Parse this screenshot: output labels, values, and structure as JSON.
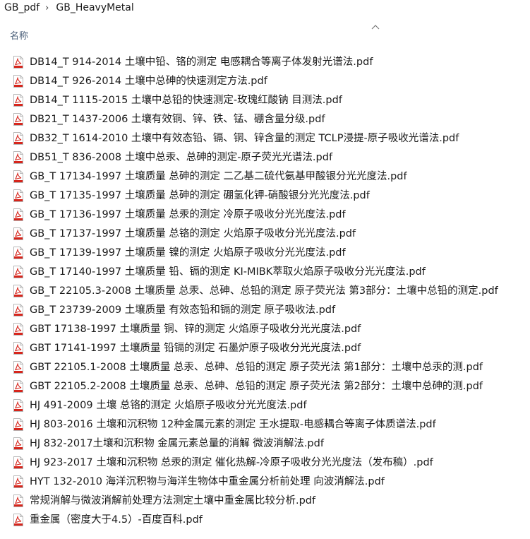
{
  "breadcrumb": {
    "items": [
      "GB_pdf",
      "GB_HeavyMetal"
    ],
    "separator": "›"
  },
  "column_header": {
    "name_label": "名称"
  },
  "files": [
    {
      "name": "DB14_T 914-2014 土壤中铅、铬的测定 电感耦合等离子体发射光谱法.pdf",
      "icon": "pdf-file-icon"
    },
    {
      "name": "DB14_T 926-2014 土壤中总砷的快速测定方法.pdf",
      "icon": "pdf-file-icon"
    },
    {
      "name": "DB14_T 1115-2015 土壤中总铅的快速测定-玫瑰红酸钠 目测法.pdf",
      "icon": "pdf-file-icon"
    },
    {
      "name": "DB21_T 1437-2006 土壤有效铜、锌、铁、锰、硼含量分级.pdf",
      "icon": "pdf-file-icon"
    },
    {
      "name": "DB32_T 1614-2010 土壤中有效态铅、镉、铜、锌含量的测定 TCLP浸提-原子吸收光谱法.pdf",
      "icon": "pdf-file-icon"
    },
    {
      "name": "DB51_T 836-2008 土壤中总汞、总砷的测定-原子荧光光谱法.pdf",
      "icon": "pdf-file-icon"
    },
    {
      "name": "GB_T 17134-1997 土壤质量 总砷的测定 二乙基二硫代氨基甲酸银分光光度法.pdf",
      "icon": "pdf-file-icon"
    },
    {
      "name": "GB_T 17135-1997 土壤质量 总砷的测定 硼氢化钾-硝酸银分光光度法.pdf",
      "icon": "pdf-file-icon"
    },
    {
      "name": "GB_T 17136-1997 土壤质量 总汞的测定 冷原子吸收分光光度法.pdf",
      "icon": "pdf-file-icon"
    },
    {
      "name": "GB_T 17137-1997 土壤质量 总铬的测定 火焰原子吸收分光光度法.pdf",
      "icon": "pdf-file-icon"
    },
    {
      "name": "GB_T 17139-1997 土壤质量 镍的测定 火焰原子吸收分光光度法.pdf",
      "icon": "pdf-file-icon"
    },
    {
      "name": "GB_T 17140-1997 土壤质量 铅、镉的测定 KI-MIBK萃取火焰原子吸收分光光度法.pdf",
      "icon": "pdf-file-icon"
    },
    {
      "name": "GB_T 22105.3-2008 土壤质量 总汞、总砷、总铅的测定 原子荧光法 第3部分：土壤中总铅的测定.pdf",
      "icon": "pdf-file-icon"
    },
    {
      "name": "GB_T 23739-2009 土壤质量 有效态铅和镉的测定 原子吸收法.pdf",
      "icon": "pdf-file-icon"
    },
    {
      "name": "GBT 17138-1997 土壤质量 铜、锌的测定 火焰原子吸收分光光度法.pdf",
      "icon": "pdf-file-icon"
    },
    {
      "name": "GBT 17141-1997 土壤质量 铅镉的测定 石墨炉原子吸收分光光度法.pdf",
      "icon": "pdf-file-icon"
    },
    {
      "name": "GBT 22105.1-2008 土壤质量 总汞、总砷、总铅的测定 原子荧光法 第1部分：土壤中总汞的测.pdf",
      "icon": "pdf-file-icon"
    },
    {
      "name": "GBT 22105.2-2008 土壤质量 总汞、总砷、总铅的测定 原子荧光法 第2部分：土壤中总砷的测.pdf",
      "icon": "pdf-file-icon"
    },
    {
      "name": "HJ 491-2009 土壤 总铬的测定 火焰原子吸收分光光度法.pdf",
      "icon": "pdf-file-icon"
    },
    {
      "name": "HJ 803-2016 土壤和沉积物 12种金属元素的测定 王水提取-电感耦合等离子体质谱法.pdf",
      "icon": "pdf-file-icon"
    },
    {
      "name": "HJ 832-2017土壤和沉积物 金属元素总量的消解 微波消解法.pdf",
      "icon": "pdf-file-icon"
    },
    {
      "name": "HJ 923-2017 土壤和沉积物 总汞的测定 催化热解-冷原子吸收分光光度法（发布稿）.pdf",
      "icon": "pdf-file-icon"
    },
    {
      "name": "HYT 132-2010 海洋沉积物与海洋生物体中重金属分析前处理 向波消解法.pdf",
      "icon": "pdf-file-icon"
    },
    {
      "name": "常规消解与微波消解前处理方法测定土壤中重金属比较分析.pdf",
      "icon": "pdf-file-icon"
    },
    {
      "name": "重金属（密度大于4.5）-百度百科.pdf",
      "icon": "pdf-file-icon"
    }
  ],
  "colors": {
    "pdf_red": "#d6251c",
    "header_text": "#4c607a"
  }
}
